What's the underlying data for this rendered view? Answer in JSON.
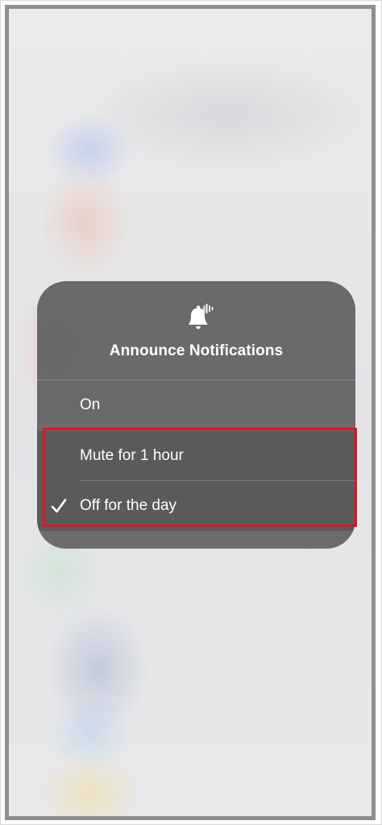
{
  "menu": {
    "icon": "bell-with-sound-waves-icon",
    "title": "Announce Notifications",
    "options": [
      {
        "label": "On",
        "selected": false
      },
      {
        "label": "Mute for 1 hour",
        "selected": false
      },
      {
        "label": "Off for the day",
        "selected": true
      }
    ]
  },
  "annotation": {
    "highlight_color": "#e3141c"
  }
}
